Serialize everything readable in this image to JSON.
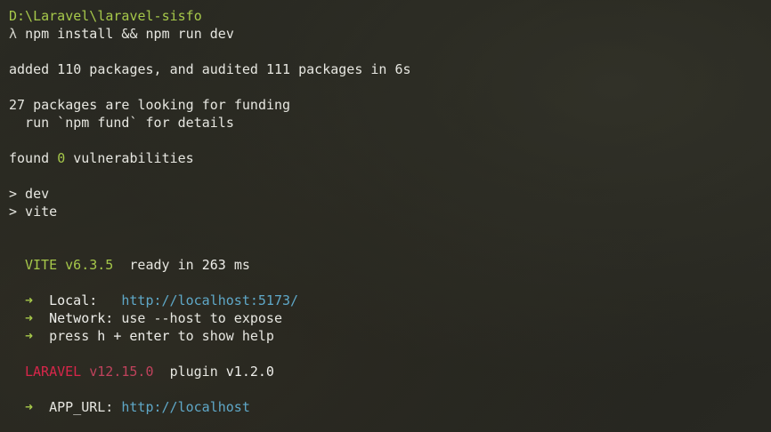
{
  "terminal": {
    "path": "D:\\Laravel\\laravel-sisfo",
    "prompt_symbol": "λ",
    "command": "npm install && npm run dev",
    "added_line": "added 110 packages, and audited 111 packages in 6s",
    "funding_line": "27 packages are looking for funding",
    "fund_hint": "  run `npm fund` for details",
    "found_prefix": "found ",
    "vuln_count": "0",
    "found_suffix": " vulnerabilities",
    "script_dev": "> dev",
    "script_vite": "> vite",
    "vite_name": "VITE",
    "vite_version": "v6.3.5",
    "ready_text": "ready in",
    "ready_ms": "263",
    "ready_unit": "ms",
    "arrow": "➜",
    "local_label": "Local:",
    "local_url_prefix": "http://localhost:",
    "local_port": "5173",
    "local_url_suffix": "/",
    "network_label": "Network:",
    "network_text": "use --host to expose",
    "help_prefix": "press",
    "help_key": "h + enter",
    "help_suffix": "to show help",
    "laravel_name": "LARAVEL",
    "laravel_version": "v12.15.0",
    "plugin_text": "plugin",
    "plugin_version": "v1.2.0",
    "app_url_label": "APP_URL:",
    "app_url": "http://localhost"
  },
  "colors": {
    "background": "#262620",
    "path": "#a6c84a",
    "link": "#5fa8c8",
    "laravel": "#d8264a"
  }
}
